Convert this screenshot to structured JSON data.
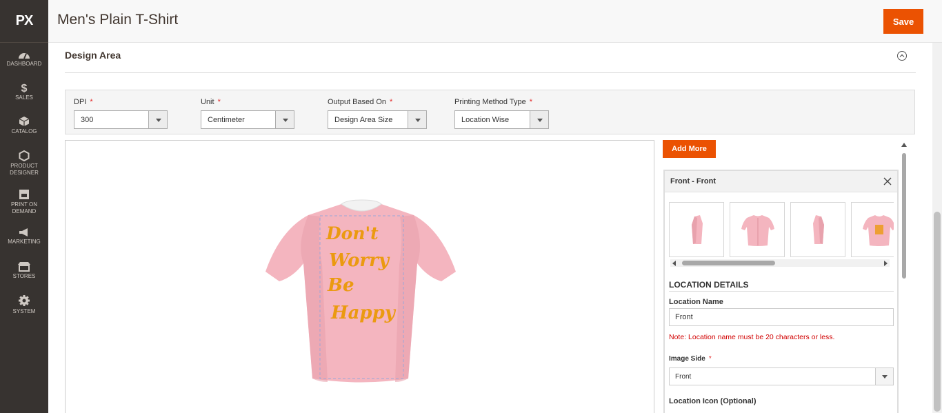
{
  "app": {
    "logo_text": "PX"
  },
  "sidebar": {
    "items": [
      {
        "label": "DASHBOARD",
        "icon": "gauge-icon"
      },
      {
        "label": "SALES",
        "icon": "dollar-icon"
      },
      {
        "label": "CATALOG",
        "icon": "cube-icon"
      },
      {
        "label_line1": "PRODUCT",
        "label_line2": "DESIGNER",
        "icon": "hexagon-icon"
      },
      {
        "label_line1": "PRINT ON",
        "label_line2": "DEMAND",
        "icon": "shop-icon"
      },
      {
        "label": "MARKETING",
        "icon": "megaphone-icon"
      },
      {
        "label": "STORES",
        "icon": "storefront-icon"
      },
      {
        "label": "SYSTEM",
        "icon": "gear-icon"
      }
    ]
  },
  "header": {
    "title": "Men's Plain T-Shirt",
    "save_label": "Save"
  },
  "design_area": {
    "title": "Design Area",
    "fields": {
      "dpi": {
        "label": "DPI",
        "value": "300"
      },
      "unit": {
        "label": "Unit",
        "value": "Centimeter"
      },
      "output": {
        "label": "Output Based On",
        "value": "Design Area Size"
      },
      "printing": {
        "label": "Printing Method Type",
        "value": "Location Wise"
      }
    },
    "required_mark": "*"
  },
  "canvas": {
    "design_text": [
      "Don't",
      "Worry",
      "Be",
      "Happy"
    ],
    "shirt_color": "#f4b5bf",
    "text_color": "#eb9a10"
  },
  "panel": {
    "add_more_label": "Add More",
    "location_title": "Front - Front",
    "details_heading": "LOCATION DETAILS",
    "location_name_label": "Location Name",
    "location_name_value": "Front",
    "note": "Note: Location name must be 20 characters or less.",
    "image_side_label": "Image Side",
    "image_side_value": "Front",
    "location_icon_label": "Location Icon (Optional)"
  },
  "colors": {
    "accent": "#eb5202",
    "sidebar": "#373330",
    "error": "#d10000"
  }
}
